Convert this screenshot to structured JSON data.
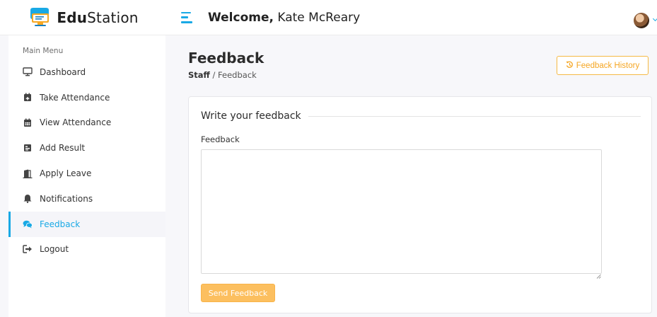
{
  "brand": {
    "name_bold": "Edu",
    "name_light": "Station"
  },
  "header": {
    "welcome_label": "Welcome,",
    "user_name": "Kate McReary"
  },
  "sidebar": {
    "title": "Main Menu",
    "items": [
      {
        "label": "Dashboard",
        "icon": "monitor-icon"
      },
      {
        "label": "Take Attendance",
        "icon": "calendar-plus-icon"
      },
      {
        "label": "View Attendance",
        "icon": "calendar-icon"
      },
      {
        "label": "Add Result",
        "icon": "report-icon"
      },
      {
        "label": "Apply Leave",
        "icon": "door-open-icon"
      },
      {
        "label": "Notifications",
        "icon": "bell-icon"
      },
      {
        "label": "Feedback",
        "icon": "comments-icon",
        "active": true
      },
      {
        "label": "Logout",
        "icon": "sign-out-icon"
      }
    ]
  },
  "page": {
    "title": "Feedback",
    "breadcrumb": {
      "root": "Staff",
      "separator": "/",
      "current": "Feedback"
    },
    "history_button": "Feedback History"
  },
  "form": {
    "legend": "Write your feedback",
    "field_label": "Feedback",
    "field_value": "",
    "submit_label": "Send Feedback"
  },
  "colors": {
    "accent": "#19a9e5",
    "warning": "#f5a623",
    "submit": "#fcbf5f"
  }
}
